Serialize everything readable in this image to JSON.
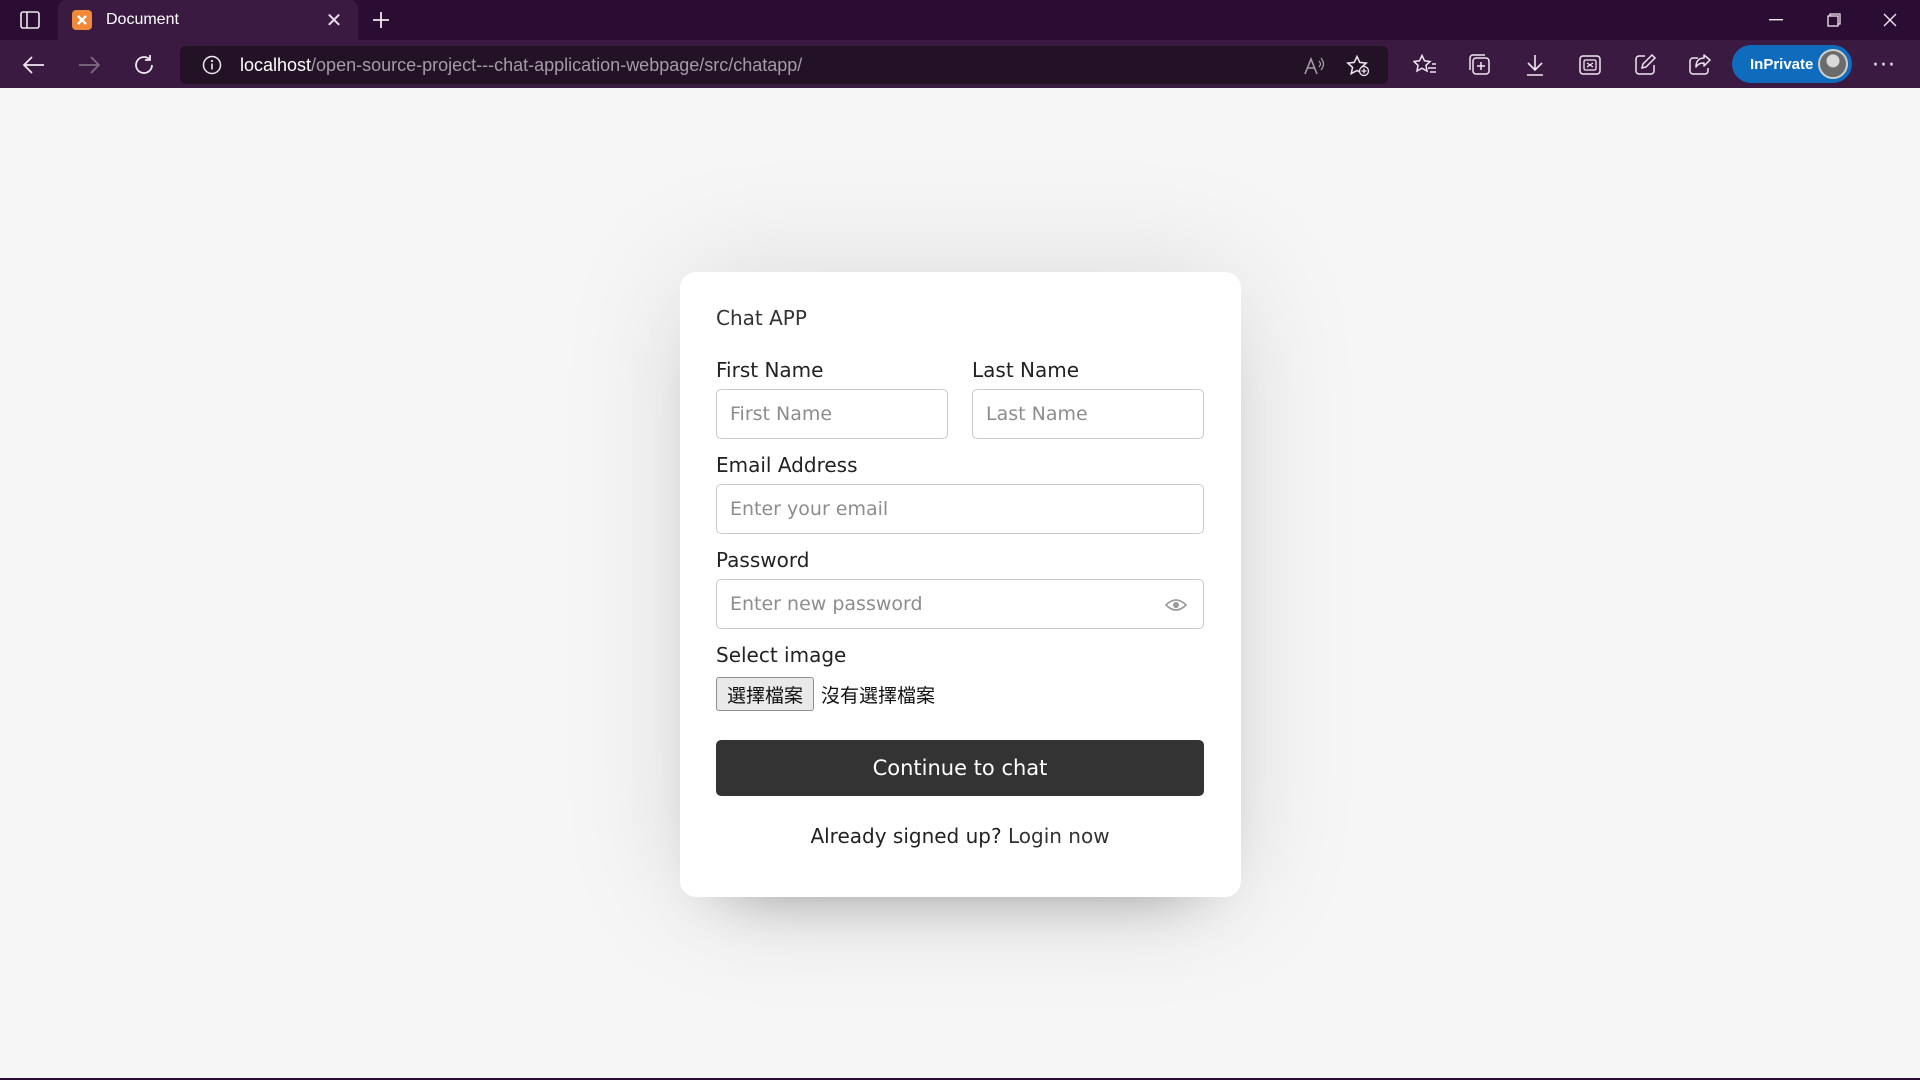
{
  "browser": {
    "tab_title": "Document",
    "url_host": "localhost",
    "url_path": "/open-source-project---chat-application-webpage/src/chatapp/",
    "inprivate_label": "InPrivate",
    "icons": {
      "tab_actions": "tab-actions-icon",
      "favicon": "xampp-favicon",
      "close_tab": "close-icon",
      "new_tab": "plus-icon",
      "minimize": "minimize-icon",
      "restore": "restore-icon",
      "close_window": "close-icon",
      "back": "back-arrow-icon",
      "forward": "forward-arrow-icon",
      "refresh": "refresh-icon",
      "site_info": "info-icon",
      "read_aloud": "read-aloud-icon",
      "add_favorite": "add-favorite-icon",
      "favorites": "favorites-icon",
      "collections": "collections-icon",
      "downloads": "download-icon",
      "screenshot": "screenshot-icon",
      "copilot": "edit-icon",
      "share": "share-icon",
      "more": "more-icon"
    }
  },
  "form": {
    "app_title": "Chat APP",
    "first_name": {
      "label": "First Name",
      "placeholder": "First Name"
    },
    "last_name": {
      "label": "Last Name",
      "placeholder": "Last Name"
    },
    "email": {
      "label": "Email Address",
      "placeholder": "Enter your email"
    },
    "password": {
      "label": "Password",
      "placeholder": "Enter new password"
    },
    "image": {
      "label": "Select image",
      "button": "選擇檔案",
      "status": "沒有選擇檔案"
    },
    "submit": "Continue to chat",
    "signup_prompt": "Already signed up?",
    "login_link": "Login now"
  },
  "colors": {
    "titlebar": "#2b0c32",
    "toolbar": "#3a1a41",
    "inprivate": "#0f6cbd",
    "page_bg": "#f6f6f6",
    "button_bg": "#333333"
  }
}
